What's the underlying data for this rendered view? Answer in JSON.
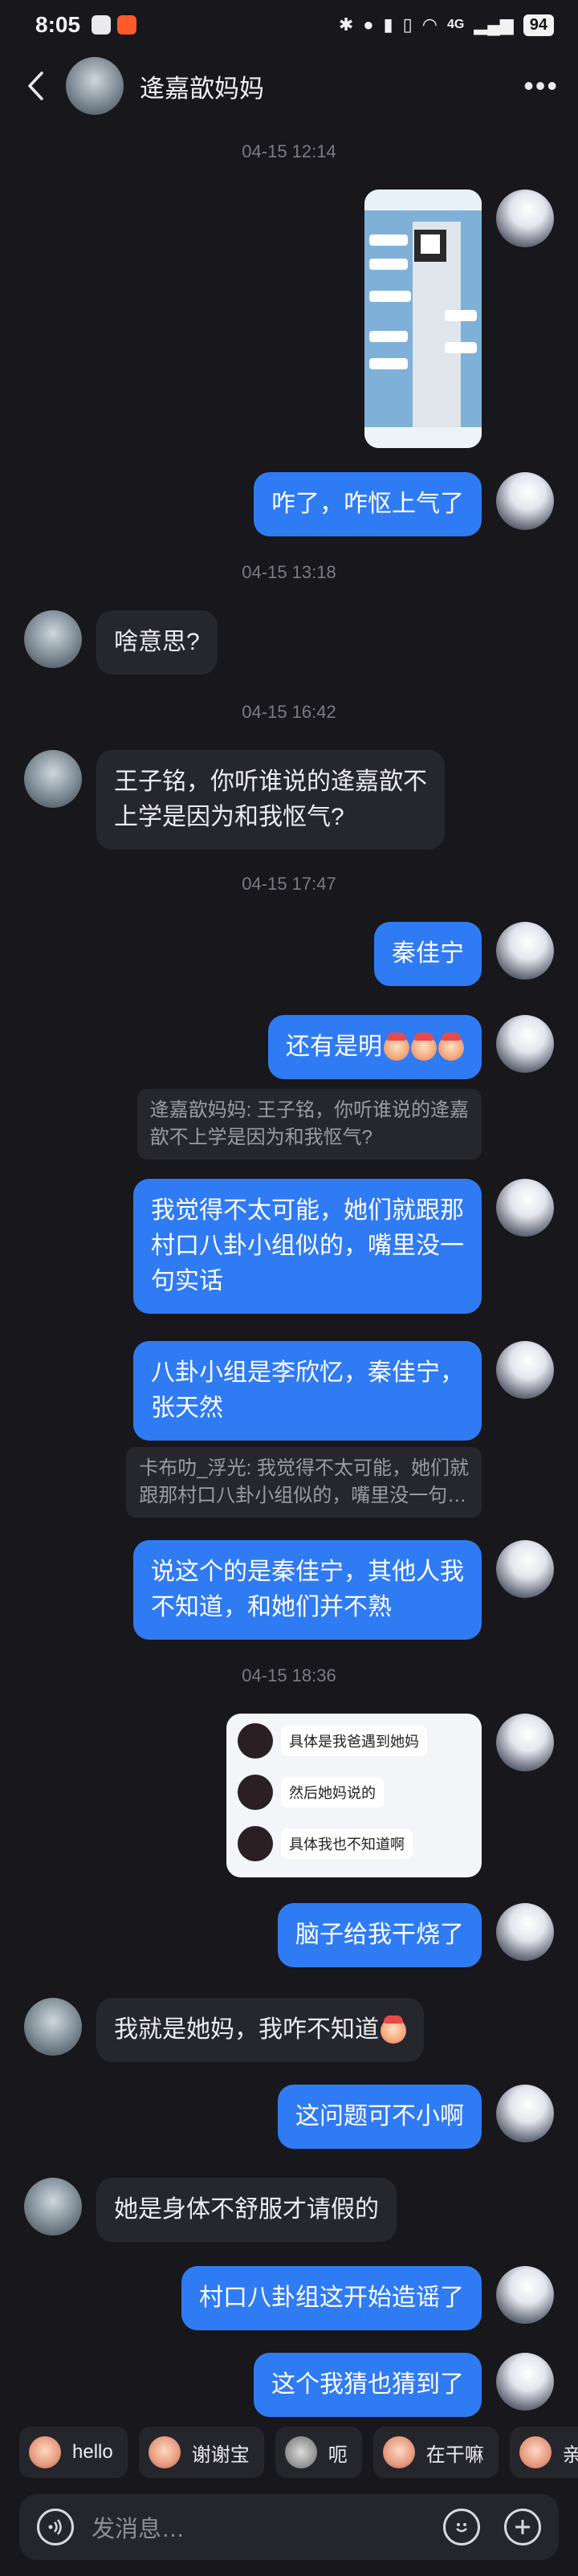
{
  "status_bar": {
    "time": "8:05",
    "icons": [
      "bluetooth-icon",
      "location-icon",
      "mic-icon",
      "vibrate-icon",
      "wifi-icon",
      "signal-icon"
    ],
    "network": "4G",
    "battery": "94"
  },
  "header": {
    "title": "逄嘉歆妈妈"
  },
  "messages": {
    "t1": "04-15 12:14",
    "m2": "咋了，咋怄上气了",
    "t2": "04-15 13:18",
    "m3": "啥意思?",
    "t3": "04-15 16:42",
    "m4": "王子铭，你听谁说的逄嘉歆不\n上学是因为和我怄气?",
    "t4": "04-15 17:47",
    "m5": "秦佳宁",
    "m6": "还有是明",
    "q6": "逄嘉歆妈妈: 王子铭，你听谁说的逄嘉\n歆不上学是因为和我怄气?",
    "m7": "我觉得不太可能，她们就跟那\n村口八卦小组似的，嘴里没一\n句实话",
    "m8": "八卦小组是李欣忆，秦佳宁，\n张天然",
    "q8": "卡布叻_浮光: 我觉得不太可能，她们就\n跟那村口八卦小组似的，嘴里没一句…",
    "m9": "说这个的是秦佳宁，其他人我\n不知道，和她们并不熟",
    "t5": "04-15 18:36",
    "img_lines": [
      "具体是我爸遇到她妈",
      "然后她妈说的",
      "具体我也不知道啊"
    ],
    "m10": "脑子给我干烧了",
    "m11": "我就是她妈，我咋不知道",
    "m12": "这问题可不小啊",
    "m13": "她是身体不舒服才请假的",
    "m14": "村口八卦组这开始造谣了",
    "m15": "这个我猜也猜到了"
  },
  "quick_replies": [
    "hello",
    "谢谢宝",
    "呃",
    "在干嘛",
    "亲"
  ],
  "input": {
    "placeholder": "发消息…"
  }
}
